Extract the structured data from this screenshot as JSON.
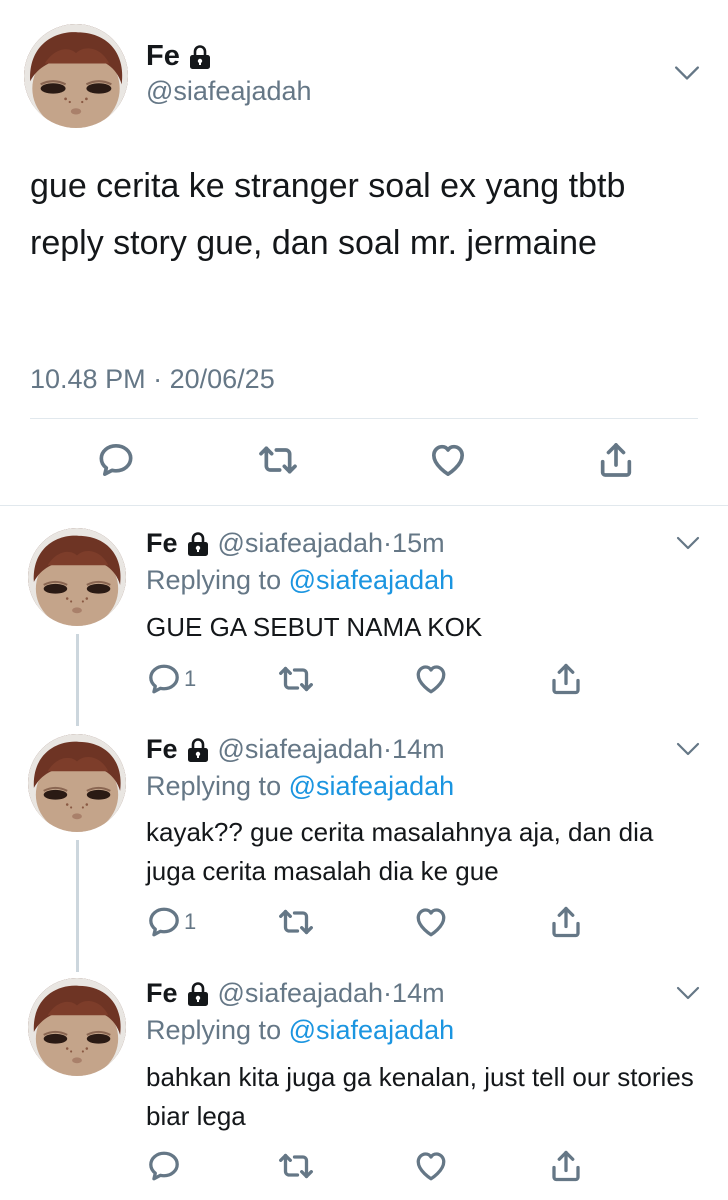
{
  "main_tweet": {
    "name": "Fe",
    "handle": "@siafeajadah",
    "text": "gue cerita ke stranger soal ex yang tbtb reply story gue, dan soal mr. jermaine",
    "time": "10.48 PM",
    "date": "20/06/25",
    "separator": "·"
  },
  "replies": [
    {
      "name": "Fe",
      "handle": "@siafeajadah",
      "time": "15m",
      "replying_prefix": "Replying to",
      "replying_to": "@siafeajadah",
      "text": "GUE GA SEBUT NAMA KOK",
      "reply_count": "1"
    },
    {
      "name": "Fe",
      "handle": "@siafeajadah",
      "time": "14m",
      "replying_prefix": "Replying to",
      "replying_to": "@siafeajadah",
      "text": "kayak?? gue cerita masalahnya aja, dan dia juga cerita masalah dia ke gue",
      "reply_count": "1"
    },
    {
      "name": "Fe",
      "handle": "@siafeajadah",
      "time": "14m",
      "replying_prefix": "Replying to",
      "replying_to": "@siafeajadah",
      "text": "bahkan kita juga ga kenalan, just tell our stories biar lega",
      "reply_count": ""
    }
  ],
  "icons": {
    "reply": "reply-icon",
    "retweet": "retweet-icon",
    "like": "heart-icon",
    "share": "share-icon",
    "lock": "lock-icon",
    "menu": "chevron-down-icon"
  },
  "colors": {
    "text": "#14171a",
    "secondary": "#657786",
    "link": "#1b95e0",
    "divider": "#e1e8ed"
  }
}
